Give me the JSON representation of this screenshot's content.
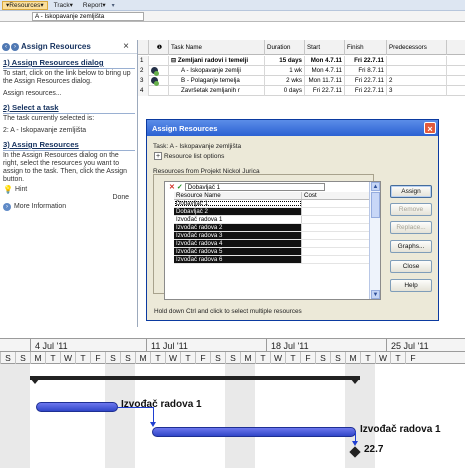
{
  "toolbar": {
    "resources": "Resources",
    "track": "Track",
    "report": "Report"
  },
  "entry_bar": {
    "value": "A - Iskopavanje zemljišta"
  },
  "task_pane": {
    "title": "Assign Resources",
    "section1_title": "1) Assign Resources dialog",
    "section1_text": "To start, click on the link below to bring up the Assign Resources dialog.",
    "assign_link": "Assign resources...",
    "section2_title": "2) Select a task",
    "section2_text": "The task currently selected is:",
    "selected_task": "2: A - Iskopavanje zemljišta",
    "section3_title": "3) Assign Resources",
    "section3_text": "In the Assign Resources dialog on the right, select the resources you want to assign to the task. Then, click the Assign button.",
    "hint": "Hint",
    "done": "Done",
    "more_info": "More Information"
  },
  "grid": {
    "headers": [
      "",
      "",
      "Task Name",
      "Duration",
      "Start",
      "Finish",
      "Predecessors"
    ],
    "rows": [
      {
        "num": "1",
        "name": "⊟ Zemljani radovi i temelji",
        "duration": "15 days",
        "start": "Mon 4.7.11",
        "finish": "Fri 22.7.11",
        "pred": "",
        "summary": true
      },
      {
        "num": "2",
        "name": "A - Iskopavanje zemlji",
        "duration": "1 wk",
        "start": "Mon 4.7.11",
        "finish": "Fri 8.7.11",
        "pred": "",
        "summary": false
      },
      {
        "num": "3",
        "name": "B - Polaganje temelja",
        "duration": "2 wks",
        "start": "Mon 11.7.11",
        "finish": "Fri 22.7.11",
        "pred": "2",
        "summary": false
      },
      {
        "num": "4",
        "name": "Završetak zemljanih r",
        "duration": "0 days",
        "start": "Fri 22.7.11",
        "finish": "Fri 22.7.11",
        "pred": "3",
        "summary": false
      }
    ]
  },
  "dialog": {
    "title": "Assign Resources",
    "task": "Task: A - Iskopavanje zemljišta",
    "resource_options": "Resource list options",
    "resources_from": "Resources from Projekt Nickol Jurica",
    "edit_value": "Dobavljač 1",
    "col_name": "Resource Name",
    "col_cost": "Cost",
    "resources": [
      {
        "name": "Dobavljač 1",
        "selected": false,
        "focus": true
      },
      {
        "name": "Dobavljač 2",
        "selected": true,
        "focus": false
      },
      {
        "name": "Izvođač radova 1",
        "selected": false,
        "focus": false
      },
      {
        "name": "Izvođač radova 2",
        "selected": true,
        "focus": false
      },
      {
        "name": "Izvođač radova 3",
        "selected": true,
        "focus": false
      },
      {
        "name": "Izvođač radova 4",
        "selected": true,
        "focus": false
      },
      {
        "name": "Izvođač radova 5",
        "selected": true,
        "focus": false
      },
      {
        "name": "Izvođač radova 6",
        "selected": true,
        "focus": false
      }
    ],
    "buttons": {
      "assign": "Assign",
      "remove": "Remove",
      "replace": "Replace...",
      "graphs": "Graphs...",
      "close": "Close",
      "help": "Help"
    },
    "footer": "Hold down Ctrl and click to select multiple resources"
  },
  "gantt": {
    "weeks": [
      "4 Jul '11",
      "11 Jul '11",
      "18 Jul '11",
      "25 Jul '11"
    ],
    "days": [
      "S",
      "S",
      "M",
      "T",
      "W",
      "T",
      "F",
      "S",
      "S",
      "M",
      "T",
      "W",
      "T",
      "F",
      "S",
      "S",
      "M",
      "T",
      "W",
      "T",
      "F",
      "S",
      "S",
      "M",
      "T",
      "W",
      "T",
      "F"
    ],
    "task1_label": "Izvođač radova 1",
    "task2_label": "Izvođač radova 1",
    "milestone_label": "22.7",
    "colors": {
      "bar": "#3e51d6",
      "summary": "#222222",
      "link": "#1f3fd1"
    }
  }
}
